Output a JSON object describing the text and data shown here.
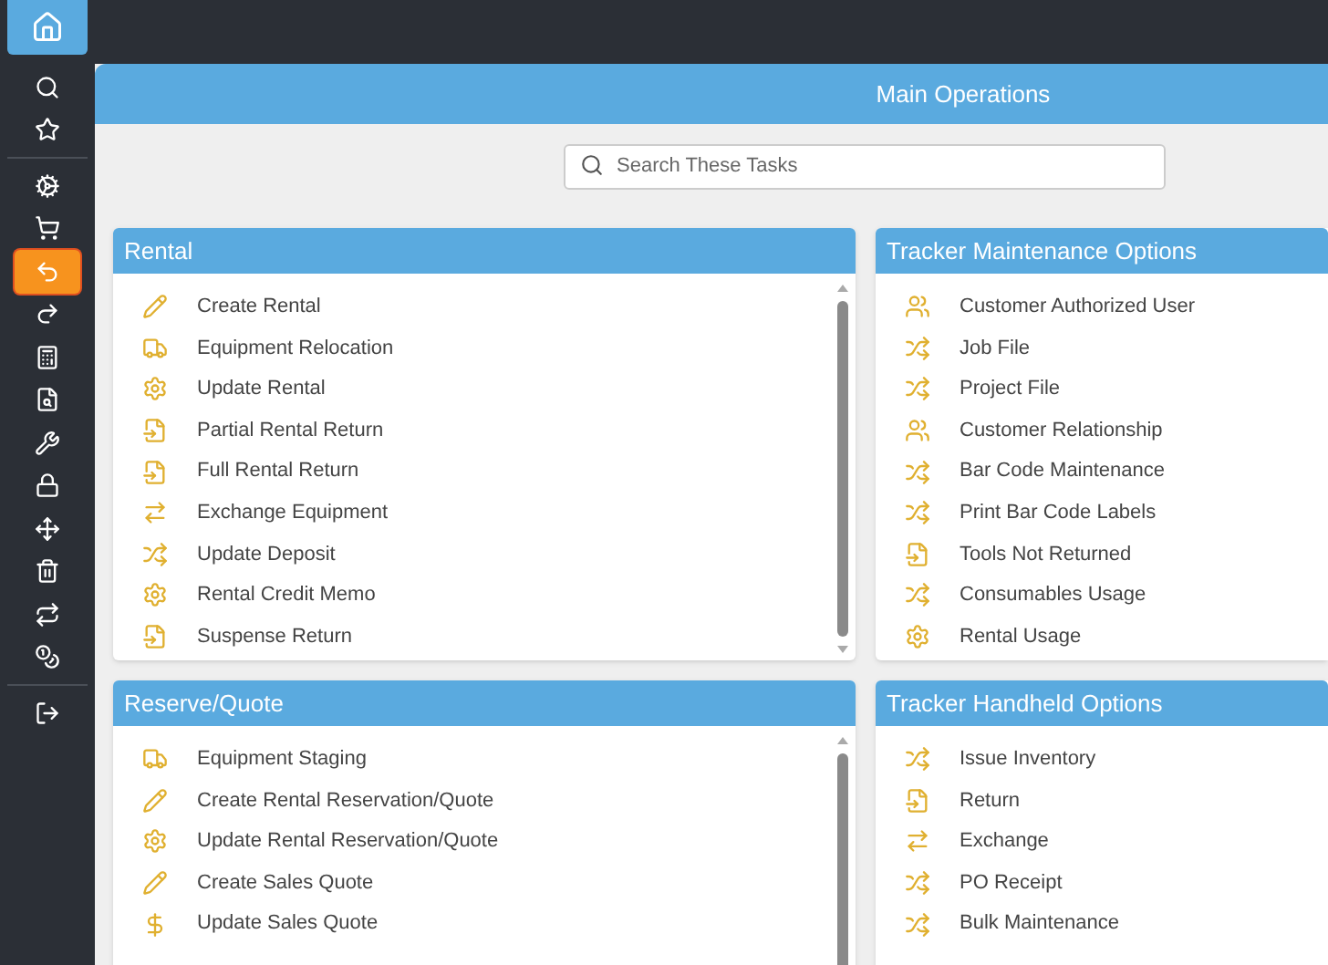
{
  "sidebar": {
    "items": [
      {
        "kind": "home",
        "selected": false
      },
      {
        "kind": "search",
        "selected": false
      },
      {
        "kind": "star",
        "selected": false
      },
      {
        "kind": "cogs",
        "selected": false
      },
      {
        "kind": "cart",
        "selected": false
      },
      {
        "kind": "return",
        "selected": true
      },
      {
        "kind": "send",
        "selected": false
      },
      {
        "kind": "calculator",
        "selected": false
      },
      {
        "kind": "file-search",
        "selected": false
      },
      {
        "kind": "wrench",
        "selected": false
      },
      {
        "kind": "lock",
        "selected": false
      },
      {
        "kind": "move",
        "selected": false
      },
      {
        "kind": "trash",
        "selected": false
      },
      {
        "kind": "repeat",
        "selected": false
      },
      {
        "kind": "coins",
        "selected": false
      },
      {
        "kind": "logout",
        "selected": false
      }
    ]
  },
  "header": {
    "title": "Main Operations"
  },
  "search": {
    "placeholder": "Search These Tasks"
  },
  "panels": [
    {
      "title": "Rental",
      "scrollable": true,
      "items": [
        {
          "kind": "pencil",
          "label": "Create Rental"
        },
        {
          "kind": "truck",
          "label": "Equipment Relocation"
        },
        {
          "kind": "gear",
          "label": "Update Rental"
        },
        {
          "kind": "file-in",
          "label": "Partial Rental Return"
        },
        {
          "kind": "file-in",
          "label": "Full Rental Return"
        },
        {
          "kind": "exchange",
          "label": "Exchange Equipment"
        },
        {
          "kind": "shuffle",
          "label": "Update Deposit"
        },
        {
          "kind": "gear",
          "label": "Rental Credit Memo"
        },
        {
          "kind": "file-in",
          "label": "Suspense Return"
        }
      ]
    },
    {
      "title": "Tracker Maintenance Options",
      "scrollable": false,
      "items": [
        {
          "kind": "users",
          "label": "Customer Authorized User"
        },
        {
          "kind": "shuffle",
          "label": "Job File"
        },
        {
          "kind": "shuffle",
          "label": "Project File"
        },
        {
          "kind": "users",
          "label": "Customer Relationship"
        },
        {
          "kind": "shuffle",
          "label": "Bar Code Maintenance"
        },
        {
          "kind": "shuffle",
          "label": "Print Bar Code Labels"
        },
        {
          "kind": "file-in",
          "label": "Tools Not Returned"
        },
        {
          "kind": "shuffle",
          "label": "Consumables Usage"
        },
        {
          "kind": "gear",
          "label": "Rental Usage"
        }
      ]
    },
    {
      "title": "Reserve/Quote",
      "scrollable": true,
      "items": [
        {
          "kind": "truck",
          "label": "Equipment Staging"
        },
        {
          "kind": "pencil",
          "label": "Create Rental Reservation/Quote"
        },
        {
          "kind": "gear",
          "label": "Update Rental Reservation/Quote"
        },
        {
          "kind": "pencil",
          "label": "Create Sales Quote"
        },
        {
          "kind": "dollar",
          "label": "Update Sales Quote"
        }
      ]
    },
    {
      "title": "Tracker Handheld Options",
      "scrollable": false,
      "items": [
        {
          "kind": "shuffle",
          "label": "Issue Inventory"
        },
        {
          "kind": "file-in",
          "label": "Return"
        },
        {
          "kind": "exchange",
          "label": "Exchange"
        },
        {
          "kind": "shuffle",
          "label": "PO Receipt"
        },
        {
          "kind": "shuffle",
          "label": "Bulk Maintenance"
        }
      ]
    }
  ]
}
